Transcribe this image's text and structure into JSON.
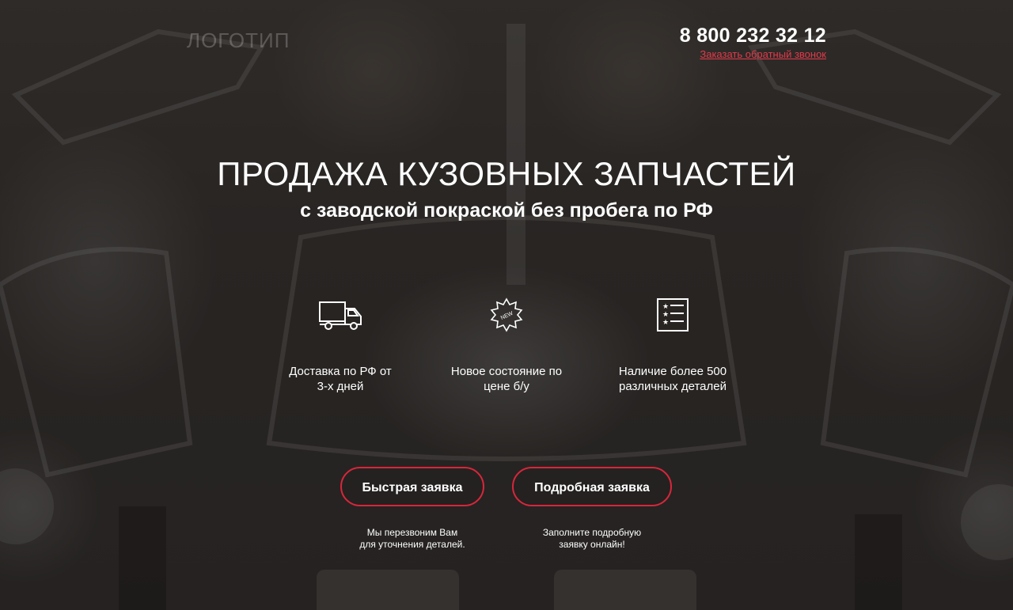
{
  "header": {
    "logo_text": "ЛОГОТИП",
    "phone": "8 800 232 32 12",
    "callback_link": "Заказать обратный звонок"
  },
  "hero": {
    "title": "ПРОДАЖА КУЗОВНЫХ ЗАПЧАСТЕЙ",
    "subtitle": "с заводской покраской без пробега по РФ"
  },
  "features": [
    {
      "icon": "delivery-truck-icon",
      "line1": "Доставка по РФ от",
      "line2": "3-х дней"
    },
    {
      "icon": "new-badge-icon",
      "line1": "Новое состояние по",
      "line2": "цене б/у"
    },
    {
      "icon": "checklist-icon",
      "line1": "Наличие более 500",
      "line2": "различных деталей"
    }
  ],
  "actions": {
    "quick": {
      "label": "Быстрая заявка",
      "note_line1": "Мы перезвоним Вам",
      "note_line2": "для уточнения деталей."
    },
    "detailed": {
      "label": "Подробная заявка",
      "note_line1": "Заполните подробную",
      "note_line2": "заявку онлайн!"
    }
  },
  "colors": {
    "accent": "#d8263b",
    "link": "#e23a4a",
    "text": "#ffffff"
  }
}
